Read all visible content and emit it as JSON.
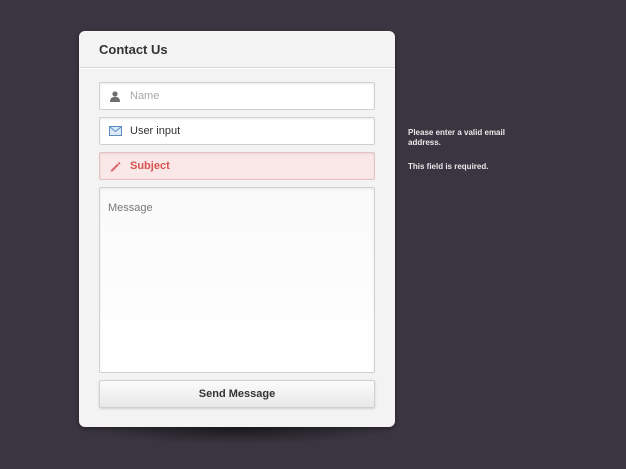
{
  "form": {
    "title": "Contact Us",
    "name_placeholder": "Name",
    "email_value": "User input",
    "subject_value": "Subject",
    "message_placeholder": "Message",
    "send_label": "Send Message"
  },
  "hints": {
    "email": "Please enter a valid email address.",
    "subject": "This field is required."
  },
  "colors": {
    "background": "#3a3540",
    "error_text": "#d9534f",
    "error_background": "#fae8e8"
  },
  "icons": {
    "name": "user-icon",
    "email": "envelope-icon",
    "subject": "pencil-icon"
  }
}
